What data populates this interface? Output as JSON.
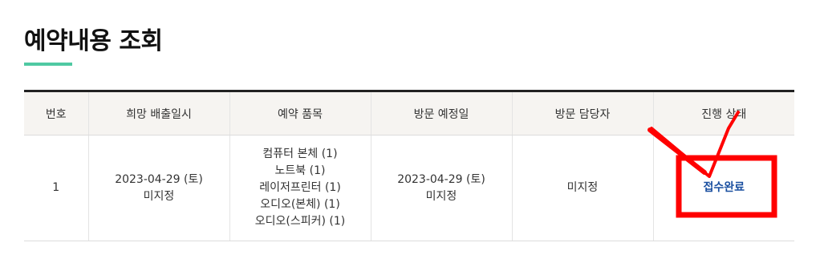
{
  "page": {
    "title": "예약내용 조회"
  },
  "table": {
    "headers": [
      "번호",
      "희망 배출일시",
      "예약 품목",
      "방문 예정일",
      "방문 담당자",
      "진행 상태"
    ],
    "rows": [
      {
        "no": "1",
        "desired_date": "2023-04-29 (토)",
        "desired_time": "미지정",
        "items": [
          "컴퓨터 본체 (1)",
          "노트북 (1)",
          "레이저프린터 (1)",
          "오디오(본체) (1)",
          "오디오(스피커) (1)"
        ],
        "visit_date": "2023-04-29 (토)",
        "visit_time": "미지정",
        "visit_staff": "미지정",
        "status": "접수완료"
      }
    ]
  },
  "colors": {
    "accent": "#4fc9a2",
    "header_bg": "#f6f4f1",
    "status_link": "#1a4fa0",
    "annotation": "#ff0000"
  }
}
